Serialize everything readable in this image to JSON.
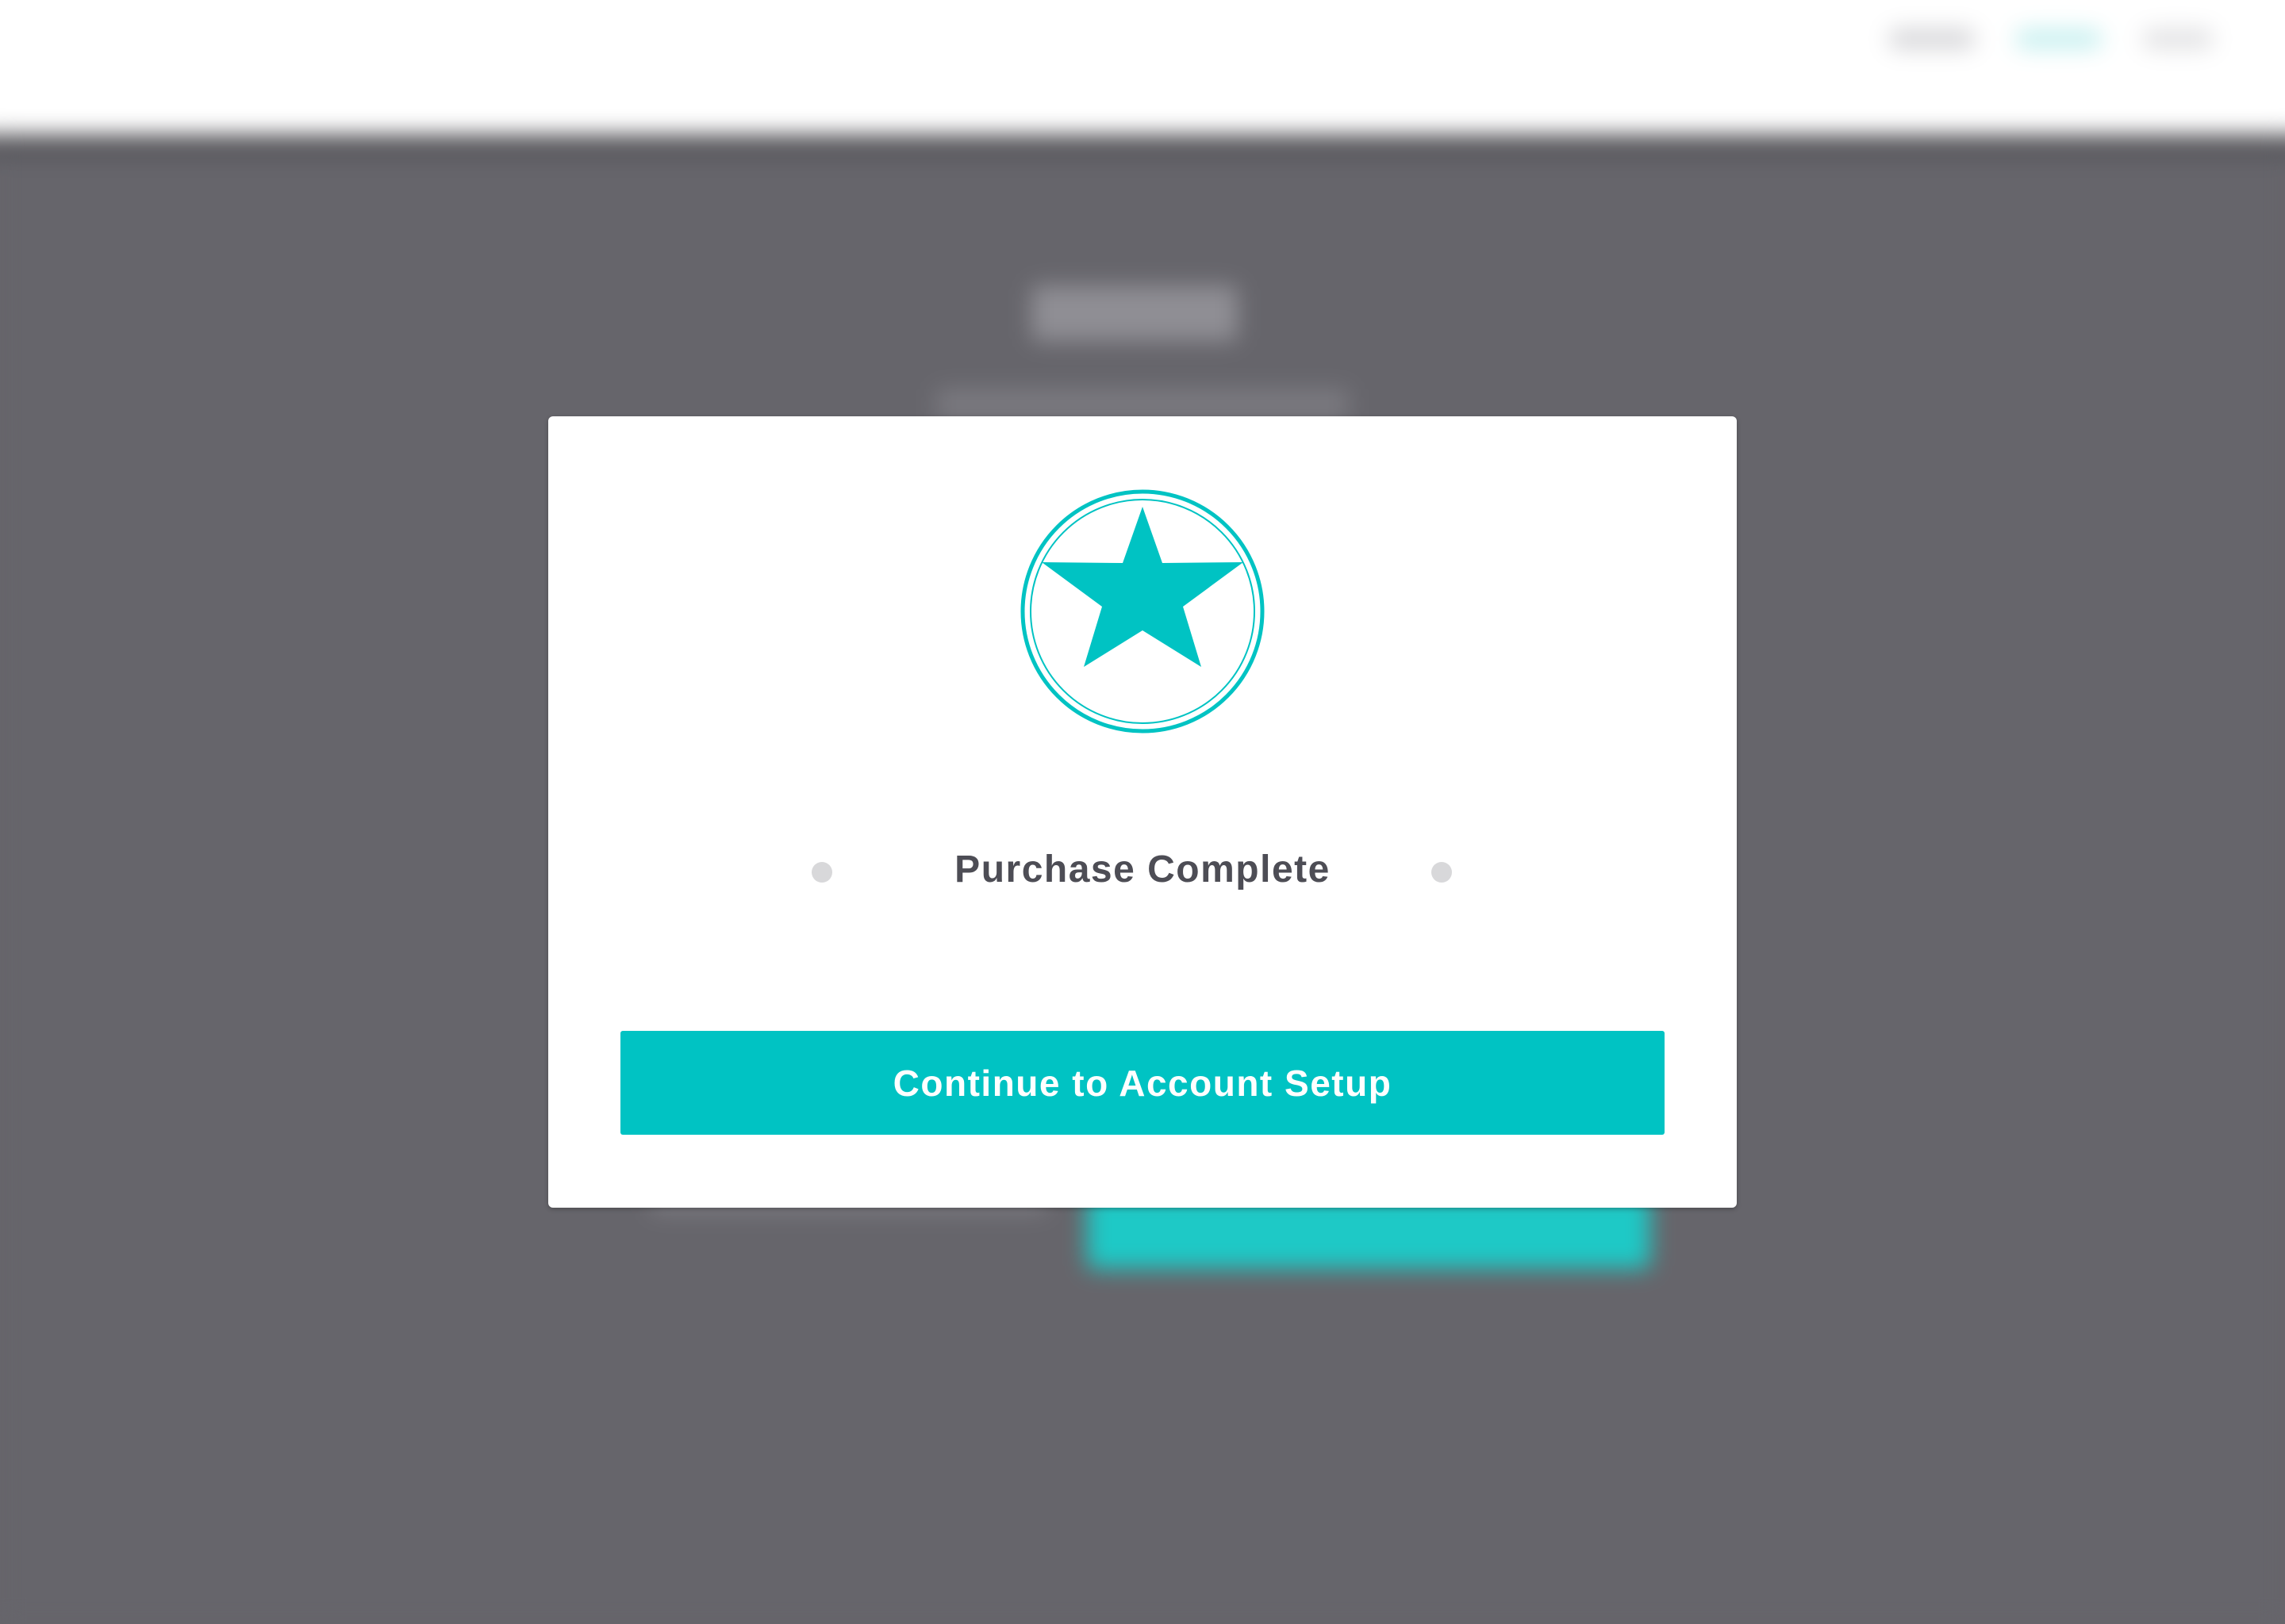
{
  "modal": {
    "status_title": "Purchase Complete",
    "continue_label": "Continue to Account Setup",
    "icon": "star-badge-icon"
  },
  "colors": {
    "accent": "#00c3c3",
    "overlay": "#66656b",
    "title_text": "#4d4d55"
  }
}
